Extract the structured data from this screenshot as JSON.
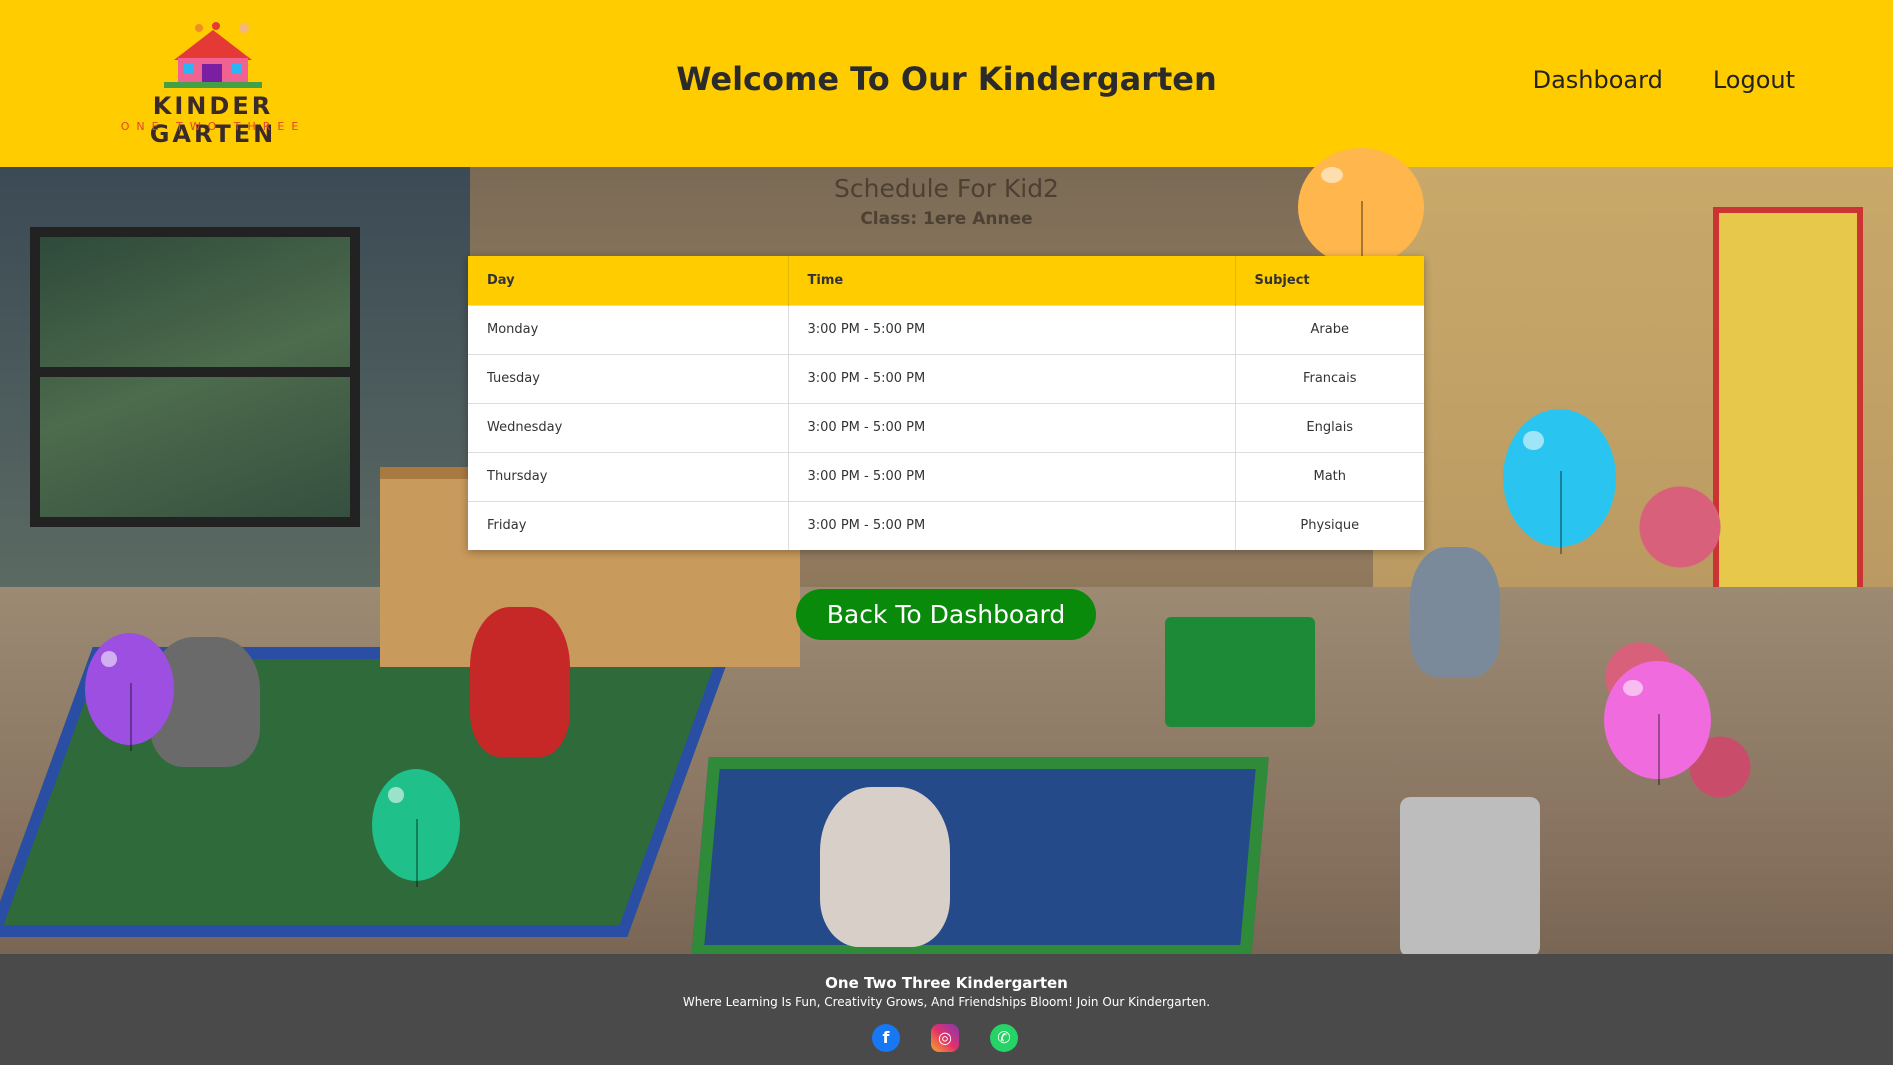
{
  "header": {
    "logo_title": "KINDER GARTEN",
    "logo_subtitle": "ONE TWO THREE",
    "title": "Welcome To Our Kindergarten",
    "nav": {
      "dashboard": "Dashboard",
      "logout": "Logout"
    }
  },
  "schedule": {
    "title": "Schedule For Kid2",
    "class_line": "Class: 1ere Annee",
    "columns": [
      "Day",
      "Time",
      "Subject"
    ],
    "rows": [
      {
        "day": "Monday",
        "time": "3:00 PM - 5:00 PM",
        "subject": "Arabe"
      },
      {
        "day": "Tuesday",
        "time": "3:00 PM - 5:00 PM",
        "subject": "Francais"
      },
      {
        "day": "Wednesday",
        "time": "3:00 PM - 5:00 PM",
        "subject": "Englais"
      },
      {
        "day": "Thursday",
        "time": "3:00 PM - 5:00 PM",
        "subject": "Math"
      },
      {
        "day": "Friday",
        "time": "3:00 PM - 5:00 PM",
        "subject": "Physique"
      }
    ]
  },
  "back_button": "Back To Dashboard",
  "footer": {
    "title": "One Two Three Kindergarten",
    "tagline": "Where Learning Is Fun, Creativity Grows, And Friendships Bloom! Join Our Kindergarten.",
    "socials": [
      "facebook-icon",
      "instagram-icon",
      "whatsapp-icon"
    ]
  },
  "colors": {
    "header_bg": "#ffcc00",
    "button_bg": "#0a8a0a",
    "footer_bg": "#4a4a4a"
  }
}
